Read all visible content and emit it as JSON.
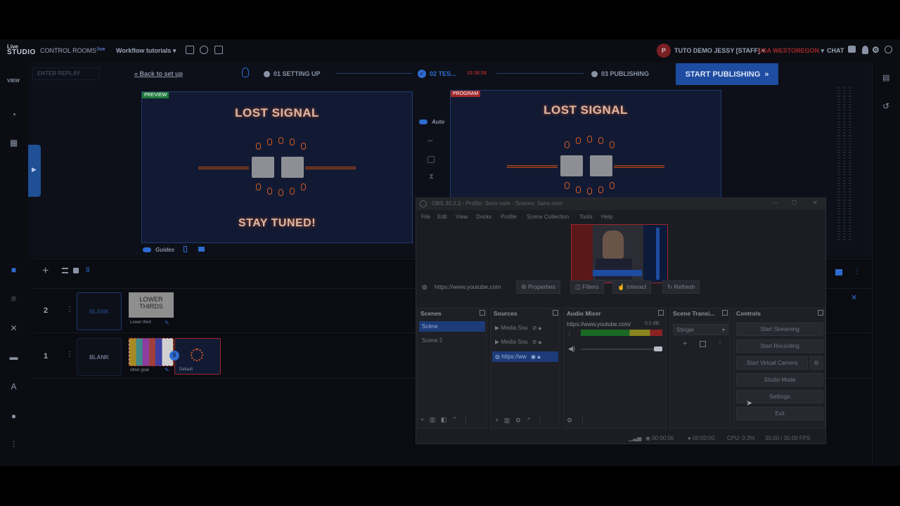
{
  "topbar": {
    "logo_top": "Live",
    "logo_bottom": "STUDIO",
    "control_rooms": "CONTROL ROOMS",
    "workflow": "Workflow tutorials",
    "user": "TUTO DEMO JESSY [STAFF]",
    "user_initial": "P",
    "region": "USA WEST",
    "region_city": "OREGON",
    "chat": "CHAT"
  },
  "workarea": {
    "view_label": "VIEW",
    "enter_replay": "ENTER REPLAY",
    "back_to_setup": "Back to set up",
    "step1": "01 SETTING UP",
    "step2": "02 TES...",
    "step2_timer": "10:38:58",
    "step3": "03 PUBLISHING",
    "publish_button": "START PUBLISHING",
    "preview_badge": "PREVIEW",
    "program_badge": "PROGRAM",
    "lost_signal": "LOST SIGNAL",
    "stay_tuned": "STAY TUNED!",
    "auto_label": "Auto",
    "guides_label": "Guides"
  },
  "tracks": {
    "row2_number": "2",
    "row1_number": "1",
    "blank": "BLANK",
    "lower_thirds_line1": "LOWER",
    "lower_thirds_line2": "THIRDS",
    "lower_third_caption": "Lower third",
    "other_caption": "other goal",
    "default_caption": "Default"
  },
  "obs": {
    "title": "OBS 30.2.3 - Profile: Sans nom - Scenes: Sans nom",
    "menu": [
      "File",
      "Edit",
      "View",
      "Docks",
      "Profile",
      "Scene Collection",
      "Tools",
      "Help"
    ],
    "url_bar": "https://www.youtube.com",
    "toolbar": [
      "Properties",
      "Filters",
      "Interact",
      "Refresh"
    ],
    "panels": {
      "scenes": "Scenes",
      "sources": "Sources",
      "audio_mixer": "Audio Mixer",
      "scene_transitions": "Scene Transi...",
      "controls": "Controls"
    },
    "scenes": [
      "Scène",
      "Scene 2"
    ],
    "sources": [
      "Media Sou",
      "Media Sou",
      "https://ww"
    ],
    "audio_source": "https://www.youtube.com/",
    "audio_db": "0.0 dB",
    "transition": "Stinger",
    "controls": [
      "Start Streaming",
      "Start Recording",
      "Start Virtual Camera",
      "Studio Mode",
      "Settings",
      "Exit"
    ],
    "status": {
      "rec1": "00:00:00",
      "rec2": "00:00:00",
      "cpu": "CPU: 0.3%",
      "fps": "30.00 / 30.00 FPS"
    }
  }
}
